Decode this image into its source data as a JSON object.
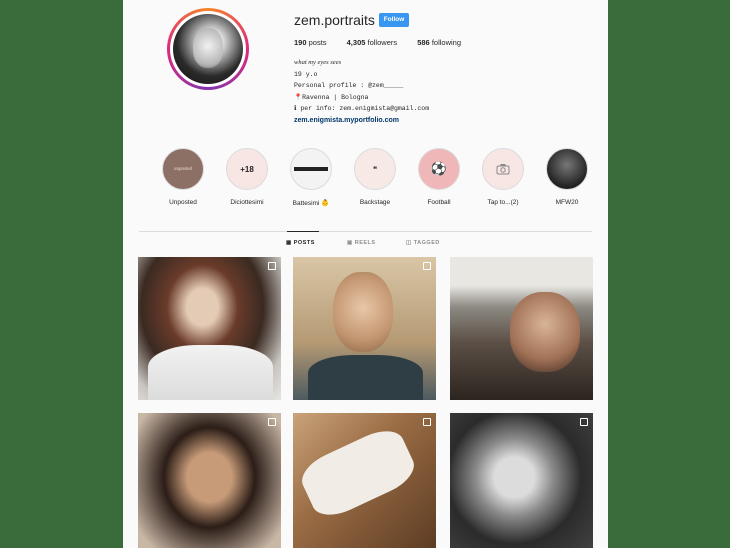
{
  "profile": {
    "username": "zem.portraits",
    "follow_label": "Follow",
    "posts_count": "190",
    "posts_label": "posts",
    "followers_count": "4,305",
    "followers_label": "followers",
    "following_count": "586",
    "following_label": "following",
    "bio": {
      "name": "what my eyes sees",
      "age": "19 y.o",
      "personal": "Personal profile : @zem_____",
      "location": "Ravenna | Bologna",
      "contact": "per info: zem.enigmista@gmail.com",
      "website": "zem.enigmista.myportfolio.com"
    }
  },
  "highlights": [
    {
      "label": "Unposted",
      "cover_text": "unposted"
    },
    {
      "label": "Diciottesimi",
      "cover_text": "+18"
    },
    {
      "label": "Battesimi 👶",
      "cover_text": ""
    },
    {
      "label": "Backstage",
      "cover_text": "❝"
    },
    {
      "label": "Football",
      "cover_text": "⚽"
    },
    {
      "label": "Tap to...(2)",
      "cover_text": ""
    },
    {
      "label": "MFW20",
      "cover_text": ""
    }
  ],
  "tabs": [
    {
      "label": "POSTS",
      "active": true
    },
    {
      "label": "REELS",
      "active": false
    },
    {
      "label": "TAGGED",
      "active": false
    }
  ],
  "colors": {
    "follow_button": "#3897f0",
    "link": "#00376b",
    "background": "#fafafa"
  }
}
